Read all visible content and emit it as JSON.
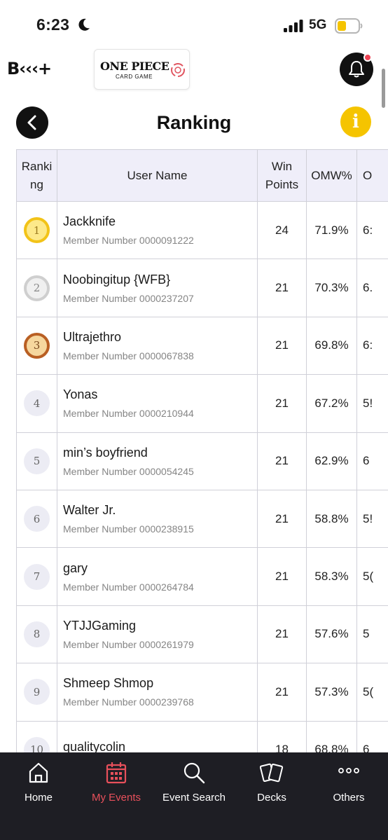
{
  "status_bar": {
    "time": "6:23",
    "network": "5G"
  },
  "header": {
    "brand": "B‹‹‹+",
    "game_logo_title": "ONE PIECE",
    "game_logo_subtitle": "CARD GAME",
    "has_notification": true,
    "accent_color": "#ee4455"
  },
  "page": {
    "title": "Ranking",
    "info_label": "i"
  },
  "table": {
    "headers": {
      "rank_line1": "Ranki",
      "rank_line2": "ng",
      "user": "User Name",
      "win_line1": "Win",
      "win_line2": "Points",
      "omw": "OMW%",
      "cut": "O"
    },
    "rows": [
      {
        "rank": "1",
        "name": "Jackknife",
        "member": "Member Number 0000091222",
        "win": "24",
        "omw": "71.9%",
        "cut": "6:"
      },
      {
        "rank": "2",
        "name": "Noobingitup {WFB}",
        "member": "Member Number 0000237207",
        "win": "21",
        "omw": "70.3%",
        "cut": "6."
      },
      {
        "rank": "3",
        "name": "Ultrajethro",
        "member": "Member Number 0000067838",
        "win": "21",
        "omw": "69.8%",
        "cut": "6:"
      },
      {
        "rank": "4",
        "name": "Yonas",
        "member": "Member Number 0000210944",
        "win": "21",
        "omw": "67.2%",
        "cut": "5!"
      },
      {
        "rank": "5",
        "name": "min’s boyfriend",
        "member": "Member Number 0000054245",
        "win": "21",
        "omw": "62.9%",
        "cut": "6"
      },
      {
        "rank": "6",
        "name": "Walter Jr.",
        "member": "Member Number 0000238915",
        "win": "21",
        "omw": "58.8%",
        "cut": "5!"
      },
      {
        "rank": "7",
        "name": "gary",
        "member": "Member Number 0000264784",
        "win": "21",
        "omw": "58.3%",
        "cut": "5("
      },
      {
        "rank": "8",
        "name": "YTJJGaming",
        "member": "Member Number 0000261979",
        "win": "21",
        "omw": "57.6%",
        "cut": "5"
      },
      {
        "rank": "9",
        "name": "Shmeep Shmop",
        "member": "Member Number 0000239768",
        "win": "21",
        "omw": "57.3%",
        "cut": "5("
      },
      {
        "rank": "10",
        "name": "qualitycolin",
        "member": "",
        "win": "18",
        "omw": "68.8%",
        "cut": "6"
      }
    ]
  },
  "bottom_nav": {
    "items": [
      {
        "label": "Home",
        "icon": "home-icon"
      },
      {
        "label": "My Events",
        "icon": "calendar-icon"
      },
      {
        "label": "Event Search",
        "icon": "search-icon"
      },
      {
        "label": "Decks",
        "icon": "cards-icon"
      },
      {
        "label": "Others",
        "icon": "more-icon"
      }
    ],
    "active_index": 1,
    "active_color": "#e8505b"
  }
}
